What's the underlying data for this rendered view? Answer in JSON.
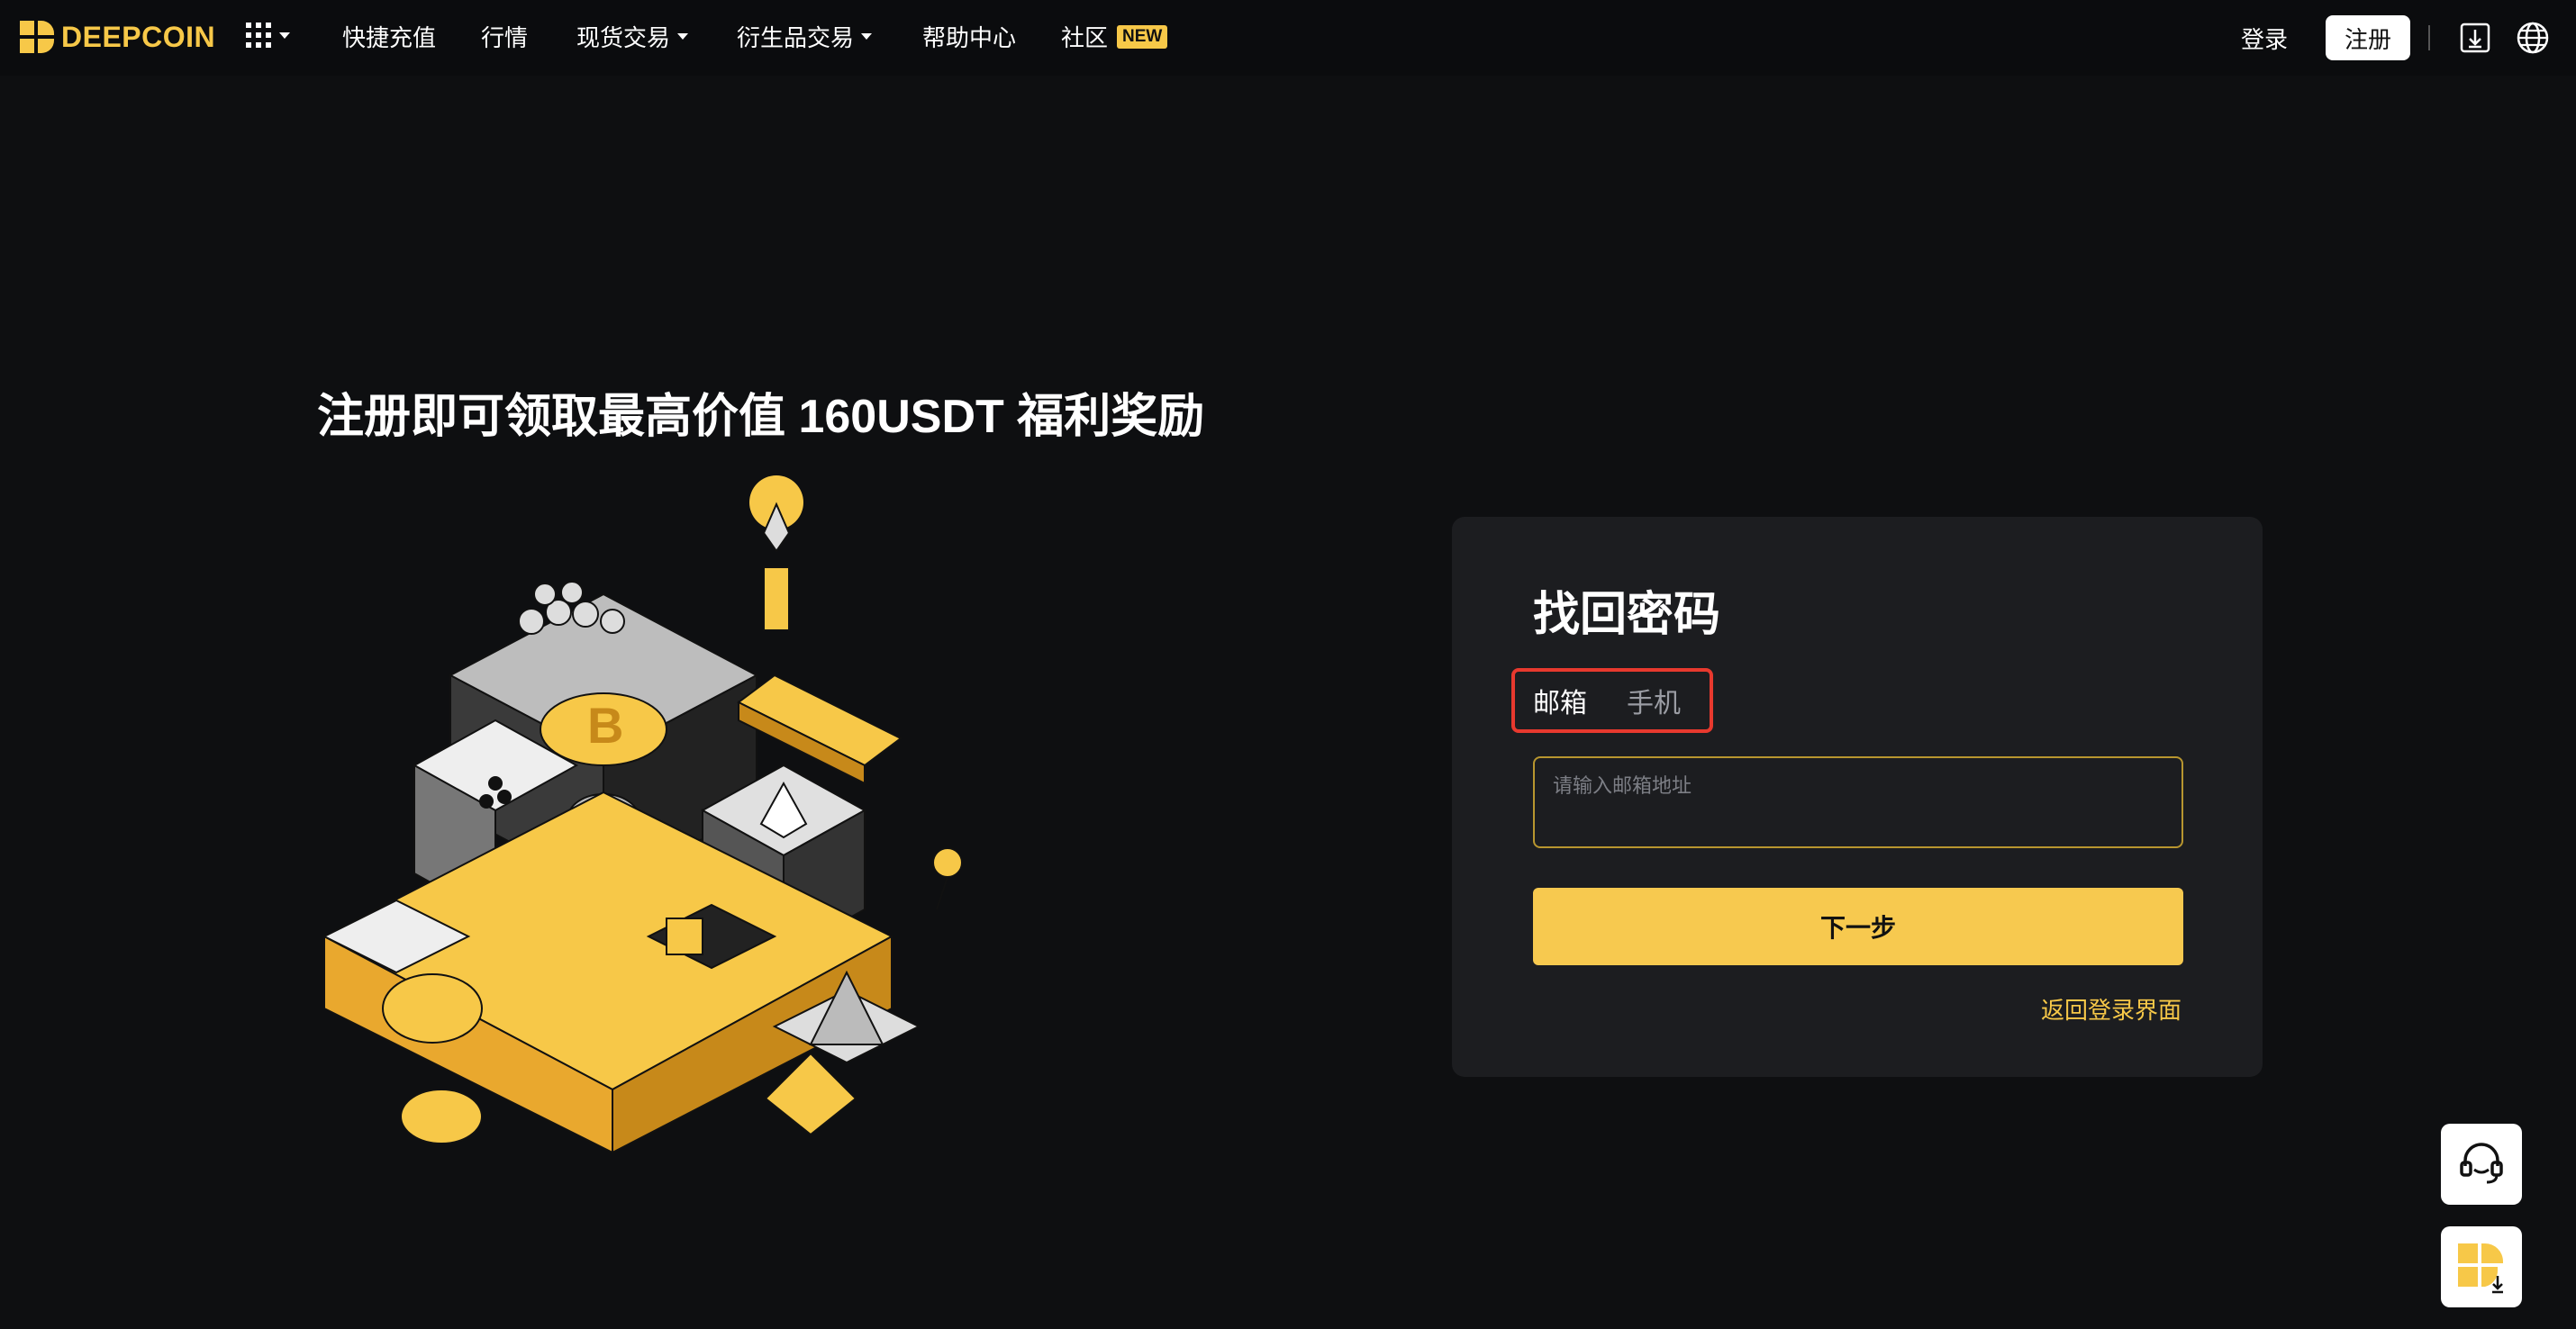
{
  "nav": {
    "logo_text": "DEEPCOIN",
    "items": [
      {
        "label": "快捷充值"
      },
      {
        "label": "行情"
      },
      {
        "label": "现货交易"
      },
      {
        "label": "衍生品交易"
      },
      {
        "label": "帮助中心"
      },
      {
        "label": "社区",
        "badge": "NEW"
      }
    ],
    "login": "登录",
    "register": "注册"
  },
  "hero": {
    "title": "注册即可领取最高价值 160USDT 福利奖励"
  },
  "form": {
    "title": "找回密码",
    "tabs": [
      {
        "label": "邮箱",
        "active": true
      },
      {
        "label": "手机",
        "active": false
      }
    ],
    "email_placeholder": "请输入邮箱地址",
    "email_value": "",
    "next_button": "下一步",
    "back_link": "返回登录界面"
  },
  "floating": {
    "support_icon": "headset-icon",
    "app_icon": "app-download-icon"
  },
  "colors": {
    "accent": "#f7c848",
    "background": "#0e0f11",
    "card": "#1c1d20",
    "highlight_border": "#e8392e"
  }
}
